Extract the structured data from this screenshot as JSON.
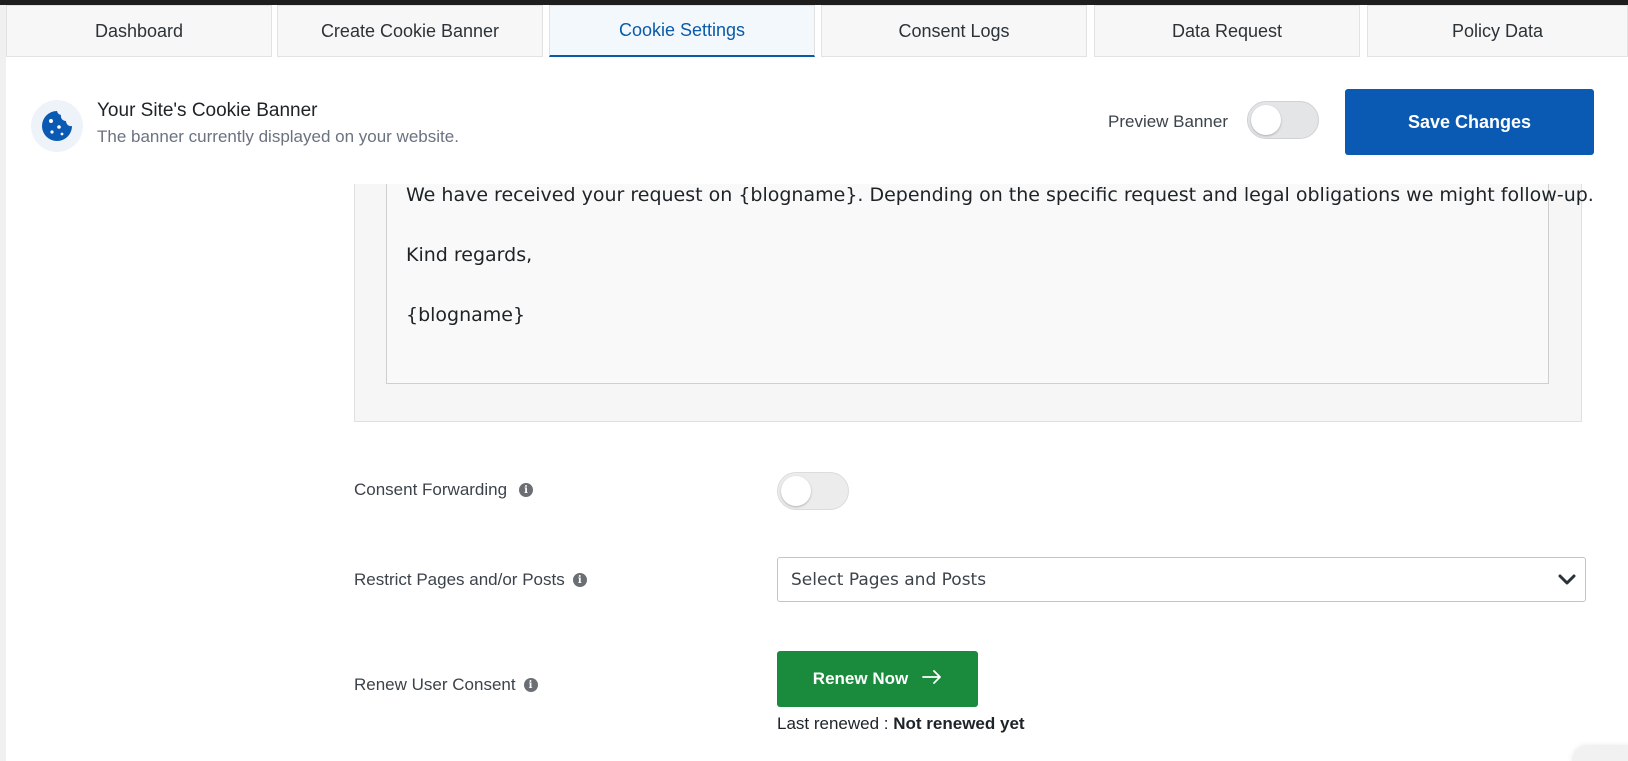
{
  "tabs": [
    {
      "label": "Dashboard",
      "active": false
    },
    {
      "label": "Create Cookie Banner",
      "active": false
    },
    {
      "label": "Cookie Settings",
      "active": true
    },
    {
      "label": "Consent Logs",
      "active": false
    },
    {
      "label": "Data Request",
      "active": false
    },
    {
      "label": "Policy Data",
      "active": false
    }
  ],
  "header": {
    "icon": "cookie-icon",
    "title": "Your Site's Cookie Banner",
    "subtitle": "The banner currently displayed on your website.",
    "preview_label": "Preview Banner",
    "preview_enabled": false,
    "save_label": "Save Changes"
  },
  "email_body": {
    "lines": [
      "We have received your request on {blogname}. Depending on the specific request and legal obligations we might follow-up.",
      "Kind regards,",
      "{blogname}"
    ]
  },
  "settings": {
    "consent_forwarding": {
      "label": "Consent Forwarding",
      "enabled": false
    },
    "restrict_pages": {
      "label": "Restrict Pages and/or Posts",
      "placeholder": "Select Pages and Posts"
    },
    "renew_consent": {
      "label": "Renew User Consent",
      "button_label": "Renew Now",
      "status_prefix": "Last renewed :",
      "status_value": "Not renewed yet"
    }
  },
  "colors": {
    "primary": "#0a5ab4",
    "success": "#1a8a3c",
    "active_tab_text": "#0a5aa8"
  }
}
